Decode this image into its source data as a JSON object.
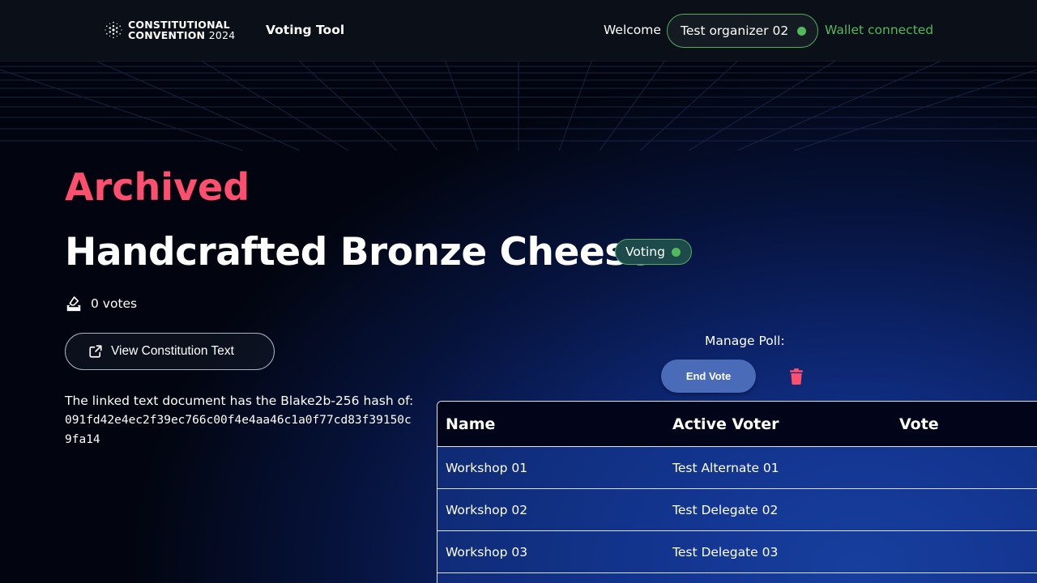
{
  "header": {
    "logo_line1": "CONSTITUTIONAL",
    "logo_line2": "CONVENTION",
    "logo_year": "2024",
    "app_name": "Voting Tool",
    "welcome": "Welcome",
    "user_name": "Test organizer 02",
    "wallet_status": "Wallet connected"
  },
  "poll": {
    "archived_label": "Archived",
    "title": "Handcrafted Bronze Cheese",
    "status_badge": "Voting",
    "votes_count": "0 votes",
    "constitution_button": "View Constitution Text",
    "hash_label": "The linked text document has the Blake2b-256 hash of:",
    "hash_line1": "091fd42e4ec2f39ec766c00f4e4aa46c1a0f77cd83f39150c",
    "hash_line2": "9fa14"
  },
  "manage": {
    "label": "Manage Poll:",
    "end_vote_button": "End Vote"
  },
  "table": {
    "headers": [
      "Name",
      "Active Voter",
      "Vote"
    ],
    "rows": [
      {
        "name": "Workshop 01",
        "voter": "Test Alternate 01",
        "vote": ""
      },
      {
        "name": "Workshop 02",
        "voter": "Test Delegate 02",
        "vote": ""
      },
      {
        "name": "Workshop 03",
        "voter": "Test Delegate 03",
        "vote": ""
      }
    ]
  },
  "colors": {
    "accent_red": "#ff4f6e",
    "status_green": "#52b95c",
    "button_blue": "#4a6bb8",
    "header_bg": "#0b0f17"
  }
}
